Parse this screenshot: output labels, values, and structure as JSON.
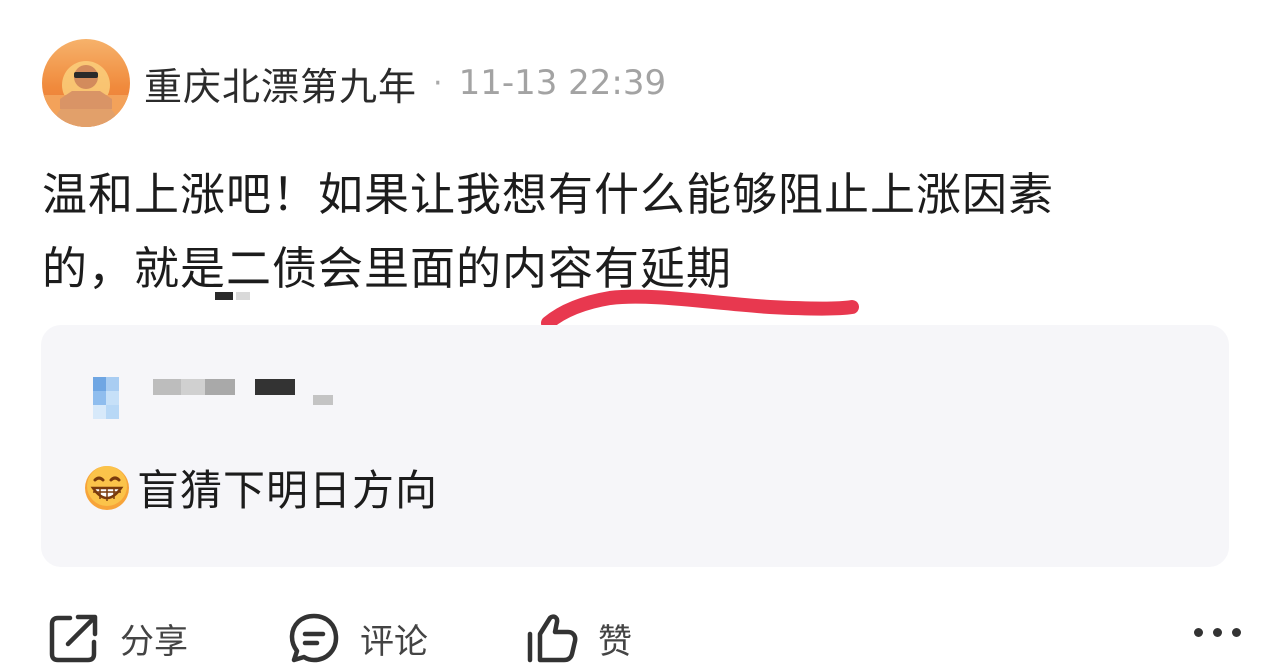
{
  "post": {
    "author": "重庆北漂第九年",
    "separator": "·",
    "time": "11-13 22:39",
    "body_line1": "温和上涨吧！如果让我想有什么能够阻止上涨因素",
    "body_line2": "的，就是二债会里面的内容有延期"
  },
  "quote": {
    "text": "盲猜下明日方向"
  },
  "actions": {
    "share": "分享",
    "comment": "评论",
    "like": "赞"
  },
  "colors": {
    "underline": "#e8384f",
    "card_background": "#f6f6f9",
    "meta_gray": "#a3a3a3"
  },
  "icons": {
    "share": "share-icon",
    "comment": "comment-icon",
    "like": "thumbs-up-icon",
    "more": "more-dots-icon",
    "emoji": "grinning-emoji-icon"
  }
}
